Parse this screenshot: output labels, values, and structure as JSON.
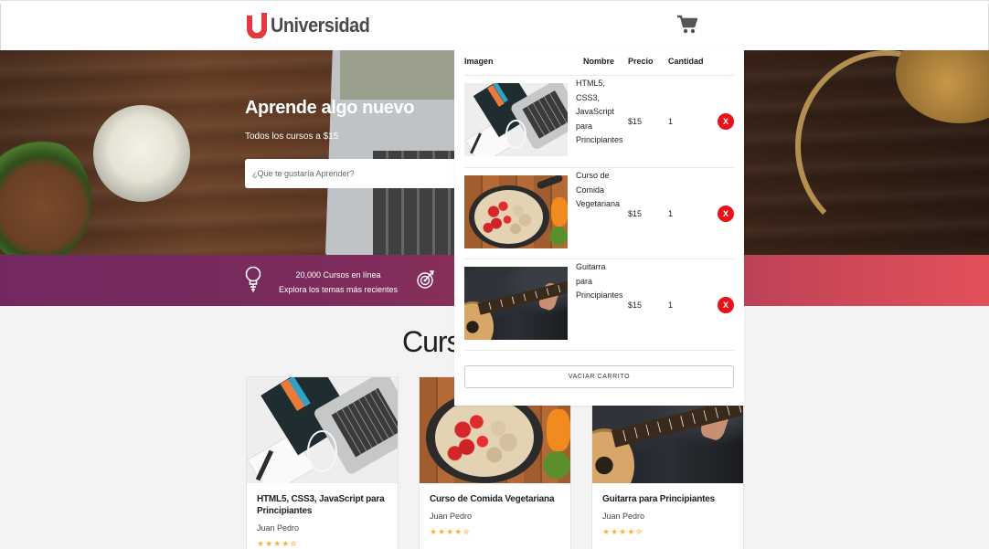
{
  "header": {
    "logo_mark": "U",
    "logo_text": "Universidad",
    "cart_icon": "cart-icon"
  },
  "hero": {
    "title": "Aprende algo nuevo",
    "subtitle": "Todos los cursos a $15",
    "search_placeholder": "¿Que te gustaría Aprender?"
  },
  "promo": {
    "line1": "20,000 Cursos en línea",
    "line2": "Explora los temas más recientes",
    "icons": [
      "lightbulb-icon",
      "target-icon"
    ]
  },
  "courses": {
    "title": "Cursos",
    "items": [
      {
        "title": "HTML5, CSS3, JavaScript para Principiantes",
        "author": "Juan Pedro",
        "stars": "★★★★✮",
        "rating": 4.5,
        "image": "html-css-book-laptop"
      },
      {
        "title": "Curso de Comida Vegetariana",
        "author": "Juan Pedro",
        "stars": "★★★★✮",
        "rating": 4.5,
        "image": "vegetables-pot"
      },
      {
        "title": "Guitarra para Principiantes",
        "author": "Juan Pedro",
        "stars": "★★★★✮",
        "rating": 4.5,
        "image": "acoustic-guitar"
      }
    ]
  },
  "cart": {
    "headers": {
      "image": "Imagen",
      "name": "Nombre",
      "price": "Precio",
      "qty": "Cantidad"
    },
    "items": [
      {
        "name": "HTML5, CSS3, JavaScript para Principiantes",
        "price": "$15",
        "qty": "1",
        "remove": "X"
      },
      {
        "name": "Curso de Comida Vegetariana",
        "price": "$15",
        "qty": "1",
        "remove": "X"
      },
      {
        "name": "Guitarra para Principiantes",
        "price": "$15",
        "qty": "1",
        "remove": "X"
      }
    ],
    "empty_label": "VACIAR CARRITO"
  },
  "colors": {
    "brand_red": "#e8131a",
    "promo_gradient_start": "#732960",
    "promo_gradient_end": "#e3505a",
    "star": "#f3b53a"
  }
}
